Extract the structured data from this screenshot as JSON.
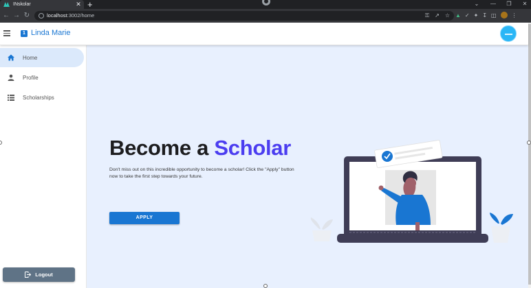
{
  "browser": {
    "tab_title": "INskolar",
    "tab_close": "✕",
    "new_tab": "+",
    "url_host": "localhost",
    "url_path": ":3002/home",
    "window_controls": [
      "⌄",
      "—",
      "❐",
      "✕"
    ]
  },
  "appbar": {
    "brand_badge": "1",
    "brand_name": "Linda Marie"
  },
  "sidebar": {
    "items": [
      {
        "label": "Home",
        "icon": "home-icon",
        "active": true
      },
      {
        "label": "Profile",
        "icon": "person-icon",
        "active": false
      },
      {
        "label": "Scholarships",
        "icon": "list-icon",
        "active": false
      }
    ],
    "logout_label": "Logout"
  },
  "hero": {
    "title_prefix": "Become a ",
    "title_accent": "Scholar",
    "description": "Don't miss out on this incredible opportunity to become a scholar! Click the \"Apply\" button now to take the first step towards your future.",
    "apply_label": "APPLY"
  },
  "colors": {
    "primary": "#1976d2",
    "accent_text": "#4b3df0",
    "main_bg": "#e8f0fe",
    "active_nav_bg": "#dbe9fb",
    "logout_bg": "#5f7386"
  }
}
